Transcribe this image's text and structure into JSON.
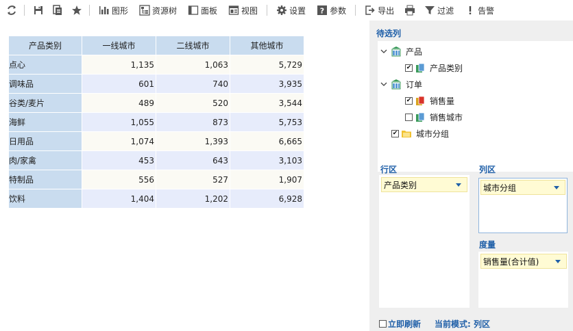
{
  "toolbar": {
    "items": [
      {
        "label": "图形"
      },
      {
        "label": "资源树"
      },
      {
        "label": "面板"
      },
      {
        "label": "视图"
      },
      {
        "label": "设置"
      },
      {
        "label": "参数"
      },
      {
        "label": "导出"
      },
      {
        "label": "过滤"
      },
      {
        "label": "告警"
      }
    ]
  },
  "table": {
    "headers": [
      "产品类别",
      "一线城市",
      "二线城市",
      "其他城市"
    ],
    "rows": [
      [
        "点心",
        "1,135",
        "1,063",
        "5,729"
      ],
      [
        "调味品",
        "601",
        "740",
        "3,935"
      ],
      [
        "谷类/麦片",
        "489",
        "520",
        "3,544"
      ],
      [
        "海鲜",
        "1,055",
        "873",
        "5,753"
      ],
      [
        "日用品",
        "1,074",
        "1,393",
        "6,665"
      ],
      [
        "肉/家禽",
        "453",
        "643",
        "3,103"
      ],
      [
        "特制品",
        "556",
        "527",
        "1,907"
      ],
      [
        "饮料",
        "1,404",
        "1,202",
        "6,928"
      ]
    ]
  },
  "panel": {
    "title": "待选列",
    "tree": {
      "n0": {
        "label": "产品"
      },
      "n0c0": {
        "label": "产品类别",
        "checked": true
      },
      "n1": {
        "label": "订单"
      },
      "n1c0": {
        "label": "销售量",
        "checked": true
      },
      "n1c1": {
        "label": "销售城市",
        "checked": false
      },
      "n2": {
        "label": "城市分组",
        "checked": true
      }
    },
    "row_zone": {
      "label": "行区",
      "field": "产品类别"
    },
    "col_zone": {
      "label": "列区",
      "field": "城市分组"
    },
    "measure_zone": {
      "label": "度量",
      "field": "销售量(合计值)"
    },
    "footer": {
      "refresh_label": "立即刷新",
      "refresh_checked": false,
      "mode_text": "当前模式: 列区"
    }
  },
  "colors": {
    "accent": "#1f5fa8",
    "header_bg": "#c9dcef",
    "row_odd": "#fbfaf4",
    "row_even": "#e7ecfb",
    "field_bg": "#fffbd4"
  }
}
